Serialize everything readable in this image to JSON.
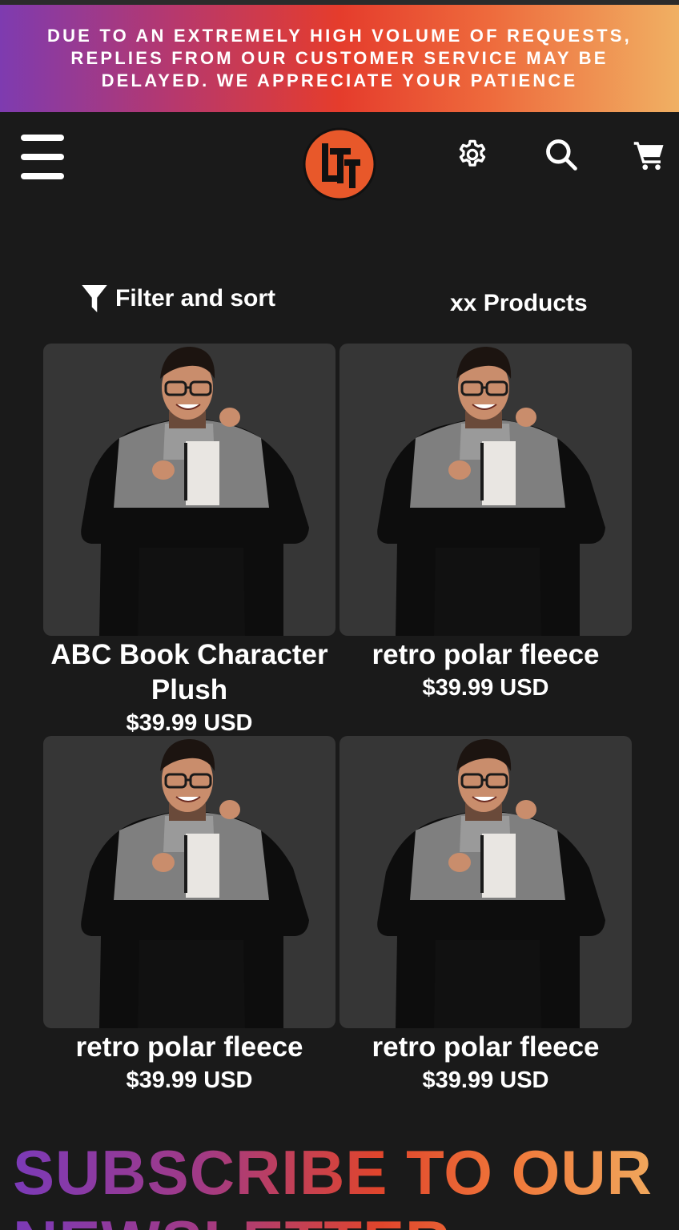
{
  "announcement": {
    "text": "DUE TO AN EXTREMELY HIGH VOLUME OF REQUESTS, REPLIES FROM OUR CUSTOMER SERVICE MAY BE DELAYED. WE APPRECIATE YOUR PATIENCE"
  },
  "header": {
    "menu_icon": "hamburger-menu-icon",
    "logo_icon": "ltt-logo",
    "settings_icon": "gear-icon",
    "search_icon": "search-icon",
    "cart_icon": "cart-icon"
  },
  "toolbar": {
    "filter_label": "Filter and sort",
    "filter_icon": "funnel-icon",
    "product_count": "xx Products"
  },
  "products": [
    {
      "title": "ABC Book Character Plush",
      "price": "$39.99 USD"
    },
    {
      "title": "retro polar fleece",
      "price": "$39.99 USD"
    },
    {
      "title": "retro polar fleece",
      "price": "$39.99 USD"
    },
    {
      "title": "retro polar fleece",
      "price": "$39.99 USD"
    }
  ],
  "newsletter": {
    "title": "SUBSCRIBE TO OUR NEWSLETTER"
  },
  "colors": {
    "background": "#1a1a1a",
    "card_background": "#363636",
    "logo_orange": "#e8582a",
    "text": "#ffffff"
  }
}
